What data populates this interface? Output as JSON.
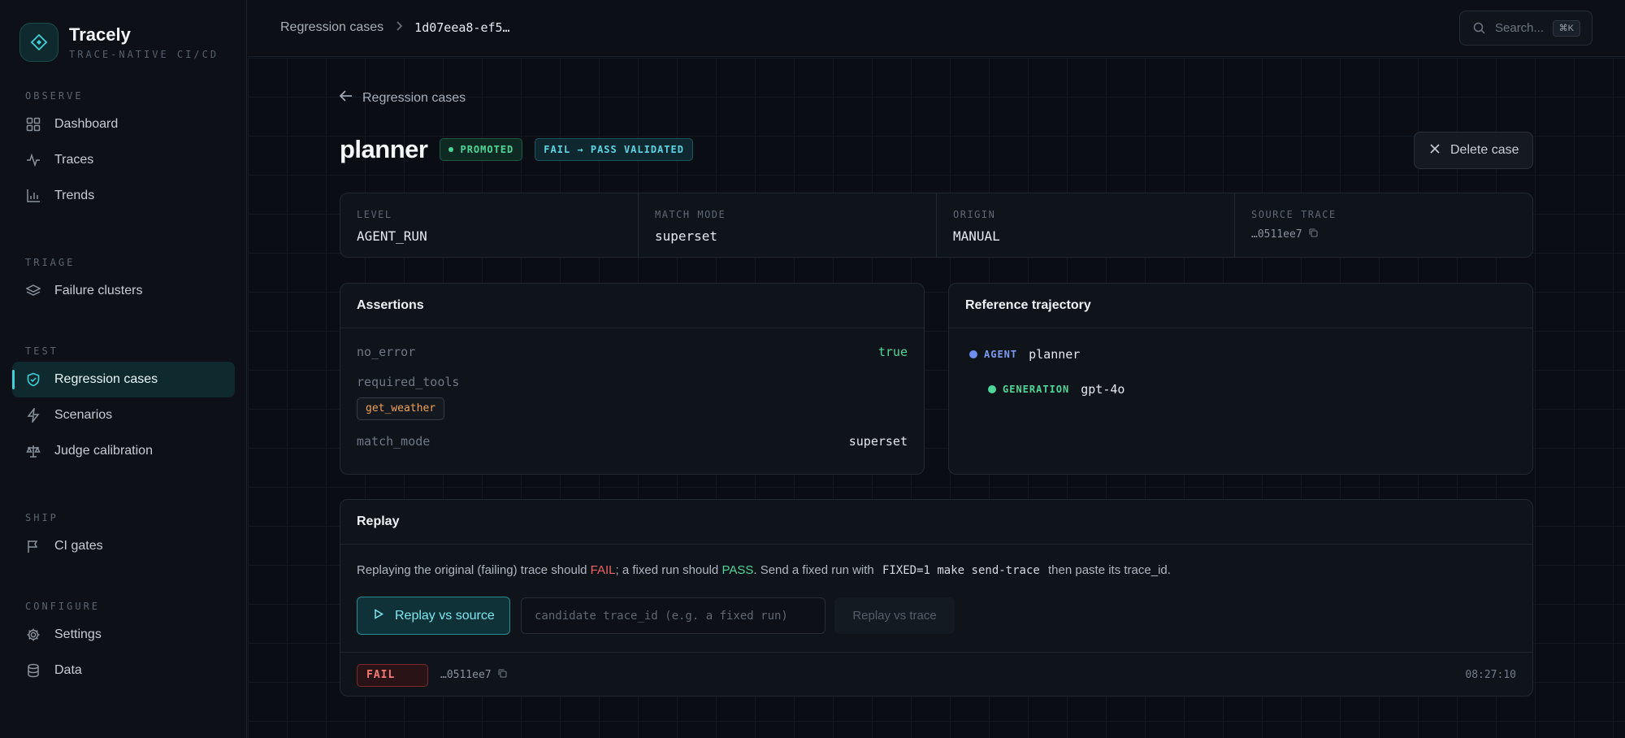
{
  "brand": {
    "name": "Tracely",
    "tagline": "TRACE-NATIVE CI/CD"
  },
  "sidebar": {
    "groups": [
      {
        "title": "OBSERVE",
        "items": [
          {
            "label": "Dashboard",
            "icon": "grid-icon"
          },
          {
            "label": "Traces",
            "icon": "pulse-icon"
          },
          {
            "label": "Trends",
            "icon": "bar-chart-icon"
          }
        ]
      },
      {
        "title": "TRIAGE",
        "items": [
          {
            "label": "Failure clusters",
            "icon": "layers-icon"
          }
        ]
      },
      {
        "title": "TEST",
        "items": [
          {
            "label": "Regression cases",
            "icon": "shield-check-icon",
            "active": true
          },
          {
            "label": "Scenarios",
            "icon": "lightning-icon"
          },
          {
            "label": "Judge calibration",
            "icon": "scale-icon"
          }
        ]
      },
      {
        "title": "SHIP",
        "items": [
          {
            "label": "CI gates",
            "icon": "flag-icon"
          }
        ]
      },
      {
        "title": "CONFIGURE",
        "items": [
          {
            "label": "Settings",
            "icon": "gear-icon"
          },
          {
            "label": "Data",
            "icon": "database-icon"
          }
        ]
      }
    ]
  },
  "header": {
    "breadcrumb_parent": "Regression cases",
    "breadcrumb_current": "1d07eea8-ef5…",
    "search_placeholder": "Search...",
    "search_shortcut": "⌘K"
  },
  "page": {
    "back_label": "Regression cases",
    "title": "planner",
    "badge_promoted": "PROMOTED",
    "badge_validated": "FAIL → PASS VALIDATED",
    "delete_label": "Delete case"
  },
  "meta": {
    "level_label": "LEVEL",
    "level_value": "AGENT_RUN",
    "match_label": "MATCH MODE",
    "match_value": "superset",
    "origin_label": "ORIGIN",
    "origin_value": "MANUAL",
    "source_label": "SOURCE TRACE",
    "source_value": "…0511ee7"
  },
  "assertions": {
    "title": "Assertions",
    "no_error_key": "no_error",
    "no_error_value": "true",
    "required_tools_key": "required_tools",
    "required_tools_chip": "get_weather",
    "match_mode_key": "match_mode",
    "match_mode_value": "superset"
  },
  "trajectory": {
    "title": "Reference trajectory",
    "agent_kind": "AGENT",
    "agent_name": "planner",
    "gen_kind": "GENERATION",
    "gen_name": "gpt-4o",
    "colors": {
      "agent": "#6f8ff0",
      "generation": "#4fd69a"
    }
  },
  "replay": {
    "title": "Replay",
    "text_a": "Replaying the original (failing) trace should ",
    "text_fail": "FAIL",
    "text_b": "; a fixed run should ",
    "text_pass": "PASS",
    "text_c": ". Send a fixed run with ",
    "text_code": "FIXED=1 make send-trace",
    "text_d": " then paste its trace_id.",
    "btn_source": "Replay vs source",
    "candidate_placeholder": "candidate trace_id (e.g. a fixed run)",
    "btn_trace": "Replay vs trace",
    "result_status": "FAIL",
    "result_trace": "…0511ee7",
    "result_time": "08:27:10"
  }
}
